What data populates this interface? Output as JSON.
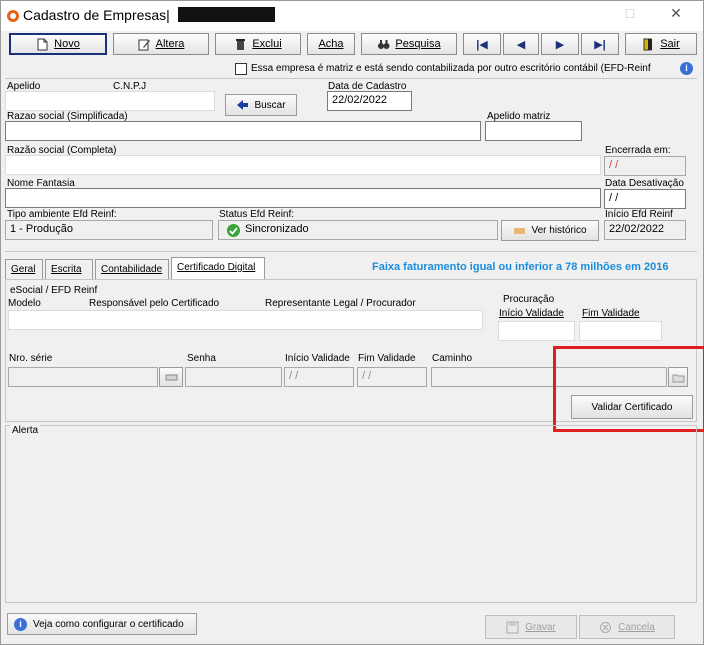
{
  "window": {
    "title": "Cadastro de Empresas|",
    "minimize": "□",
    "close": "✕"
  },
  "toolbar": {
    "novo": "Novo",
    "altera": "Altera",
    "exclui": "Exclui",
    "acha": "Acha",
    "pesquisa": "Pesquisa",
    "first": "|◀",
    "prev": "◀",
    "next": "▶",
    "last": "▶|",
    "sair": "Sair"
  },
  "matriz_check": {
    "label": "Essa empresa é matriz e está sendo contabilizada por outro escritório contábil (EFD-Reinf",
    "info_icon": "i"
  },
  "form": {
    "apelido_label": "Apelido",
    "cnpj_label": "C.N.P.J",
    "buscar_label": "Buscar",
    "data_cadastro_label": "Data de Cadastro",
    "data_cadastro_value": "22/02/2022",
    "razao_simplificada_label": "Razao social (Simplificada)",
    "apelido_matriz_label": "Apelido matriz",
    "razao_completa_label": "Razão social (Completa)",
    "encerrada_label": "Encerrada em:",
    "encerrada_value": "/ /",
    "nome_fantasia_label": "Nome Fantasia",
    "data_desativacao_label": "Data Desativação",
    "data_desativacao_value": "/ /",
    "tipo_ambiente_label": "Tipo ambiente Efd Reinf:",
    "tipo_ambiente_value": "1 - Produção",
    "status_label": "Status Efd Reinf:",
    "status_value": "Sincronizado",
    "ver_historico_label": "Ver histórico",
    "inicio_efd_label": "Início Efd Reinf",
    "inicio_efd_value": "22/02/2022"
  },
  "tabs": [
    {
      "label": "Geral"
    },
    {
      "label": "Escrita"
    },
    {
      "label": "Contabilidade"
    },
    {
      "label": "Certificado Digital"
    }
  ],
  "faixa_text": "Faixa faturamento igual ou inferior a 78 milhões em 2016",
  "certificado": {
    "esocial_label": "eSocial / EFD Reinf",
    "modelo_label": "Modelo",
    "responsavel_label": "Responsável pelo Certificado",
    "representante_label": "Representante Legal / Procurador",
    "procuracao_label": "Procuração",
    "inicio_validade_label": "Início Validade",
    "fim_validade_label": "Fim Validade",
    "nro_serie_label": "Nro. série",
    "senha_label": "Senha",
    "inicio_validade2_label": "Início Validade",
    "fim_validade2_label": "Fim Validade",
    "caminho_label": "Caminho",
    "inicio_validade2_value": "/ /",
    "fim_validade2_value": "/ /",
    "validar_label": "Validar Certificado"
  },
  "alerta_label": "Alerta",
  "footer": {
    "veja_label": "Veja como configurar o certificado",
    "gravar_label": "Gravar",
    "cancela_label": "Cancela"
  },
  "colors": {
    "faixa_blue": "#1c8ddb",
    "highlight_red": "#e02020",
    "status_green": "#3aa33a",
    "active_border": "#1b2f7a"
  }
}
